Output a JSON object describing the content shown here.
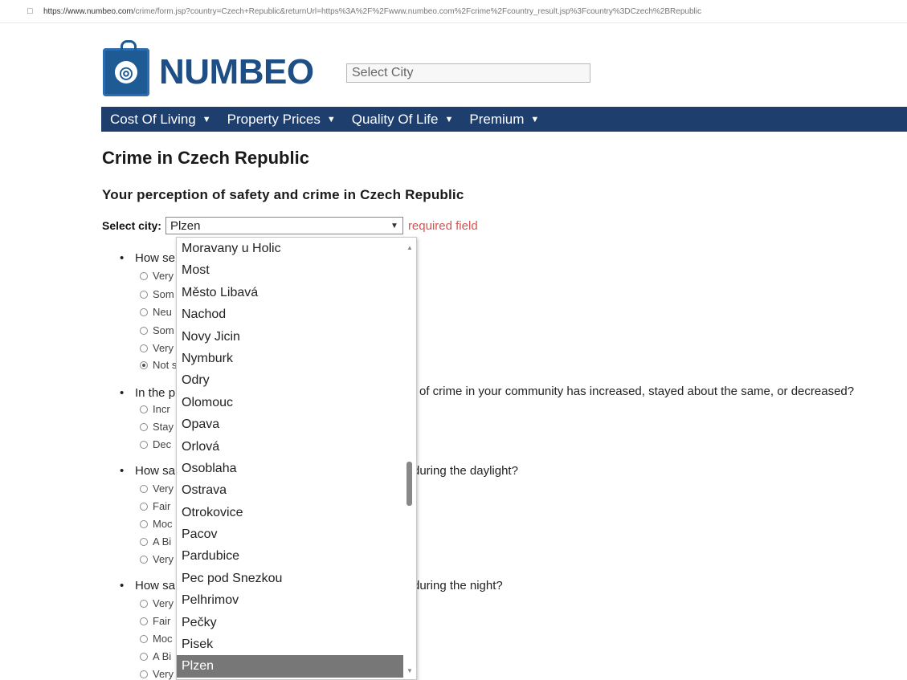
{
  "browser": {
    "url_host": "https://www.numbeo.com",
    "url_path": "/crime/form.jsp?country=Czech+Republic&returnUrl=https%3A%2F%2Fwww.numbeo.com%2Fcrime%2Fcountry_result.jsp%3Fcountry%3DCzech%2BRepublic"
  },
  "header": {
    "logo_text": "NUMBEO",
    "city_search_placeholder": "Select City"
  },
  "nav": {
    "items": [
      {
        "label": "Cost Of Living"
      },
      {
        "label": "Property Prices"
      },
      {
        "label": "Quality Of Life"
      },
      {
        "label": "Premium"
      }
    ]
  },
  "page": {
    "title": "Crime in Czech Republic",
    "subtitle": "Your perception of safety and crime in Czech Republic",
    "select_city_label": "Select city:",
    "selected_city": "Plzen",
    "required_text": "required field"
  },
  "questions": [
    {
      "text_left": "How se",
      "text_right": "",
      "options": [
        "Very",
        "Som",
        "Neu",
        "Som",
        "Very",
        "Not s"
      ],
      "checked_index": 5
    },
    {
      "text_left": "In the p",
      "text_right": "of crime in your community has increased, stayed about the same, or decreased?",
      "options": [
        "Incr",
        "Stay",
        "Dec"
      ],
      "checked_index": -1
    },
    {
      "text_left": "How sa",
      "text_right": "during the daylight?",
      "options": [
        "Very",
        "Fair",
        "Moc",
        "A Bi",
        "Very"
      ],
      "checked_index": -1
    },
    {
      "text_left": "How sa",
      "text_right": "during the night?",
      "options": [
        "Very",
        "Fair",
        "Moc",
        "A Bi",
        "Very"
      ],
      "checked_index": -1
    }
  ],
  "dropdown": {
    "options": [
      "Moravany u Holic",
      "Most",
      "Město Libavá",
      "Nachod",
      "Novy Jicin",
      "Nymburk",
      "Odry",
      "Olomouc",
      "Opava",
      "Orlová",
      "Osoblaha",
      "Ostrava",
      "Otrokovice",
      "Pacov",
      "Pardubice",
      "Pec pod Snezkou",
      "Pelhrimov",
      "Pečky",
      "Pisek",
      "Plzen"
    ],
    "selected": "Plzen"
  }
}
